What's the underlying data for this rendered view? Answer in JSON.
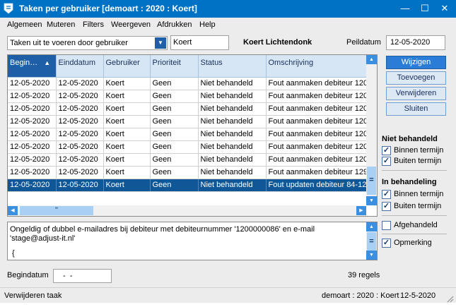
{
  "window": {
    "title": "Taken per gebruiker  [demoart : 2020 : Koert]",
    "controls": {
      "minimize": "—",
      "maximize": "☐",
      "close": "✕"
    }
  },
  "menu": [
    "Algemeen",
    "Muteren",
    "Filters",
    "Weergeven",
    "Afdrukken",
    "Help"
  ],
  "filter": {
    "combo_value": "Taken uit te voeren door gebruiker",
    "user_code": "Koert",
    "user_name": "Koert Lichtendonk",
    "peildatum_label": "Peildatum",
    "peildatum_value": "12-05-2020"
  },
  "grid": {
    "columns": [
      "Begin…",
      "Einddatum",
      "Gebruiker",
      "Prioriteit",
      "Status",
      "Omschrijving"
    ],
    "rows": [
      [
        "12-05-2020",
        "12-05-2020",
        "Koert",
        "Geen",
        "Niet behandeld",
        "Fout aanmaken debiteur  120"
      ],
      [
        "12-05-2020",
        "12-05-2020",
        "Koert",
        "Geen",
        "Niet behandeld",
        "Fout aanmaken debiteur  120"
      ],
      [
        "12-05-2020",
        "12-05-2020",
        "Koert",
        "Geen",
        "Niet behandeld",
        "Fout aanmaken debiteur  120"
      ],
      [
        "12-05-2020",
        "12-05-2020",
        "Koert",
        "Geen",
        "Niet behandeld",
        "Fout aanmaken debiteur  120"
      ],
      [
        "12-05-2020",
        "12-05-2020",
        "Koert",
        "Geen",
        "Niet behandeld",
        "Fout aanmaken debiteur  120"
      ],
      [
        "12-05-2020",
        "12-05-2020",
        "Koert",
        "Geen",
        "Niet behandeld",
        "Fout aanmaken debiteur  120"
      ],
      [
        "12-05-2020",
        "12-05-2020",
        "Koert",
        "Geen",
        "Niet behandeld",
        "Fout aanmaken debiteur  120"
      ],
      [
        "12-05-2020",
        "12-05-2020",
        "Koert",
        "Geen",
        "Niet behandeld",
        "Fout aanmaken debiteur  129"
      ],
      [
        "12-05-2020",
        "12-05-2020",
        "Koert",
        "Geen",
        "Niet behandeld",
        "Fout updaten debiteur  84-12"
      ]
    ],
    "selected_row": 8,
    "vscroll_grip": "=",
    "hscroll_grip": "\""
  },
  "buttons": {
    "wijzigen": "Wijzigen",
    "toevoegen": "Toevoegen",
    "verwijderen": "Verwijderen",
    "sluiten": "Sluiten"
  },
  "filters": {
    "niet_behandeld_title": "Niet behandeld",
    "nb_binnen": {
      "label": "Binnen termijn",
      "checked": true
    },
    "nb_buiten": {
      "label": "Buiten termijn",
      "checked": true
    },
    "in_behandeling_title": "In behandeling",
    "ib_binnen": {
      "label": "Binnen termijn",
      "checked": true
    },
    "ib_buiten": {
      "label": "Buiten termijn",
      "checked": true
    },
    "afgehandeld": {
      "label": "Afgehandeld",
      "checked": false
    },
    "opmerking": {
      "label": "Opmerking",
      "checked": true
    }
  },
  "memo": {
    "text": "Ongeldig of dubbel e-mailadres bij debiteur met debiteurnummer '1200000086' en e-mail 'stage@adjust-it.nl'",
    "tail": "{",
    "scroll_grip": "="
  },
  "footer": {
    "begindatum_label": "Begindatum",
    "begindatum_value": " -  -",
    "count_text": "39 regels"
  },
  "statusbar": {
    "left": "Verwijderen taak",
    "context": "demoart : 2020 : Koert",
    "date": "12-5-2020"
  },
  "colors": {
    "titlebar": "#0072c6",
    "selected_row": "#0f5797",
    "header": "#d6e6f5",
    "primary_button": "#2a7cd6"
  },
  "icons": [
    "app-icon",
    "dropdown-arrow-icon",
    "sort-up-icon",
    "scroll-up-icon",
    "scroll-down-icon",
    "scroll-left-icon",
    "scroll-right-icon",
    "resize-grip-icon"
  ]
}
